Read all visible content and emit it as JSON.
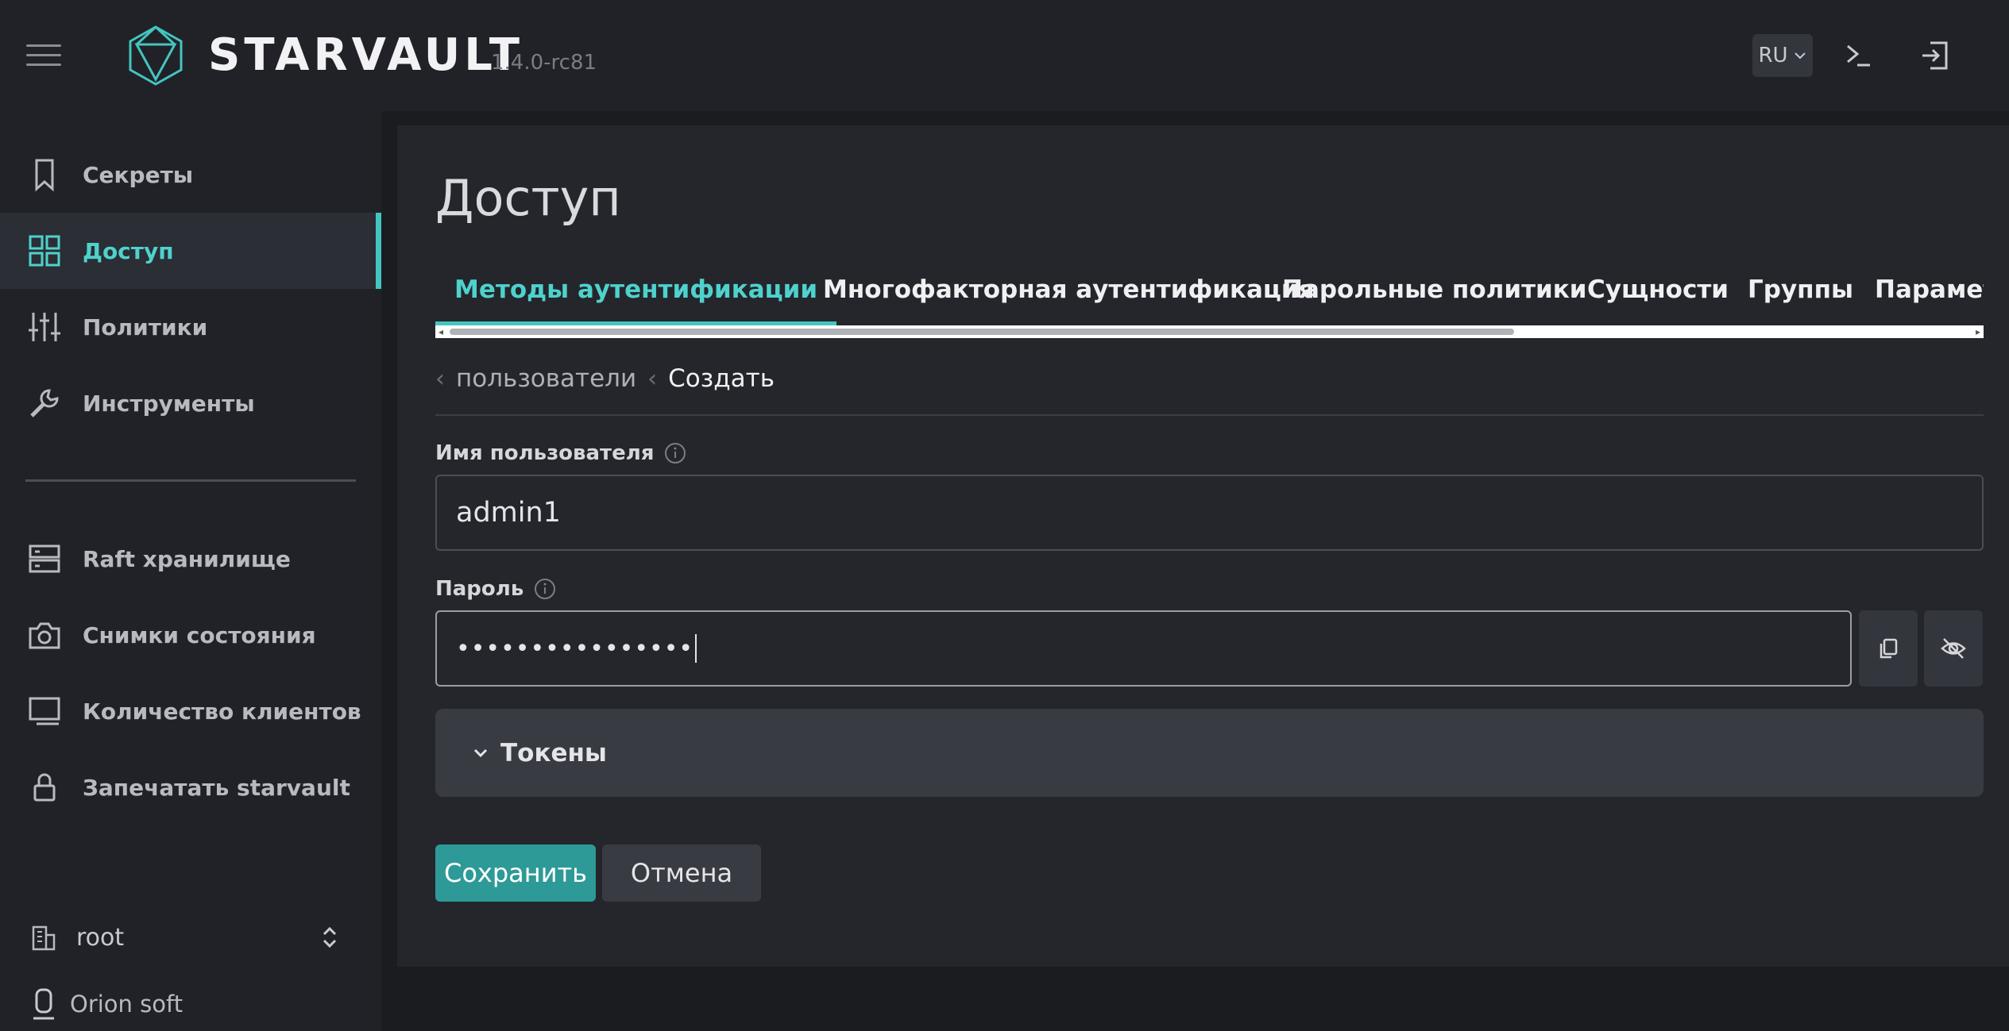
{
  "header": {
    "brand": "STARVAULT",
    "version": "1.4.0-rc81",
    "language": "RU"
  },
  "sidebar": {
    "items": [
      {
        "label": "Секреты",
        "icon": "bookmark-icon"
      },
      {
        "label": "Доступ",
        "icon": "grid-icon",
        "active": true
      },
      {
        "label": "Политики",
        "icon": "sliders-icon"
      },
      {
        "label": "Инструменты",
        "icon": "wrench-icon"
      },
      {
        "label": "Raft хранилище",
        "icon": "server-icon"
      },
      {
        "label": "Снимки состояния",
        "icon": "camera-icon"
      },
      {
        "label": "Количество клиентов",
        "icon": "monitor-icon"
      },
      {
        "label": "Запечатать starvault",
        "icon": "lock-icon"
      }
    ],
    "namespace": "root",
    "org": "Orion soft"
  },
  "main": {
    "title": "Доступ",
    "tabs": [
      {
        "label": "Методы аутентификации",
        "active": true
      },
      {
        "label": "Многофакторная аутентификация"
      },
      {
        "label": "Парольные политики"
      },
      {
        "label": "Сущности"
      },
      {
        "label": "Группы"
      },
      {
        "label": "Параметры"
      }
    ],
    "breadcrumb": {
      "parent": "пользователи",
      "current": "Создать"
    },
    "form": {
      "username_label": "Имя пользователя",
      "username_value": "admin1",
      "password_label": "Пароль",
      "password_value": "••••••••••••••••",
      "tokens_label": "Токены"
    },
    "actions": {
      "save": "Сохранить",
      "cancel": "Отмена"
    }
  },
  "colors": {
    "accent": "#45c4c0",
    "primary_button": "#2e9a97",
    "background": "#1a1c20",
    "sidebar": "#202227"
  }
}
